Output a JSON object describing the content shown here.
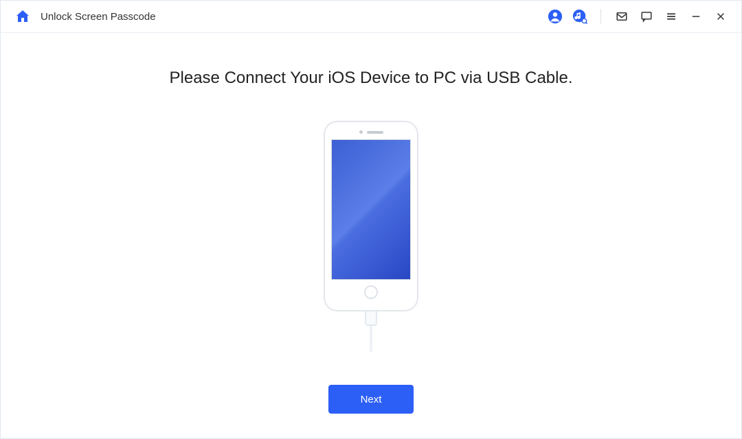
{
  "titlebar": {
    "title": "Unlock Screen Passcode"
  },
  "main": {
    "heading": "Please Connect Your iOS Device to PC via USB Cable.",
    "next_label": "Next"
  }
}
